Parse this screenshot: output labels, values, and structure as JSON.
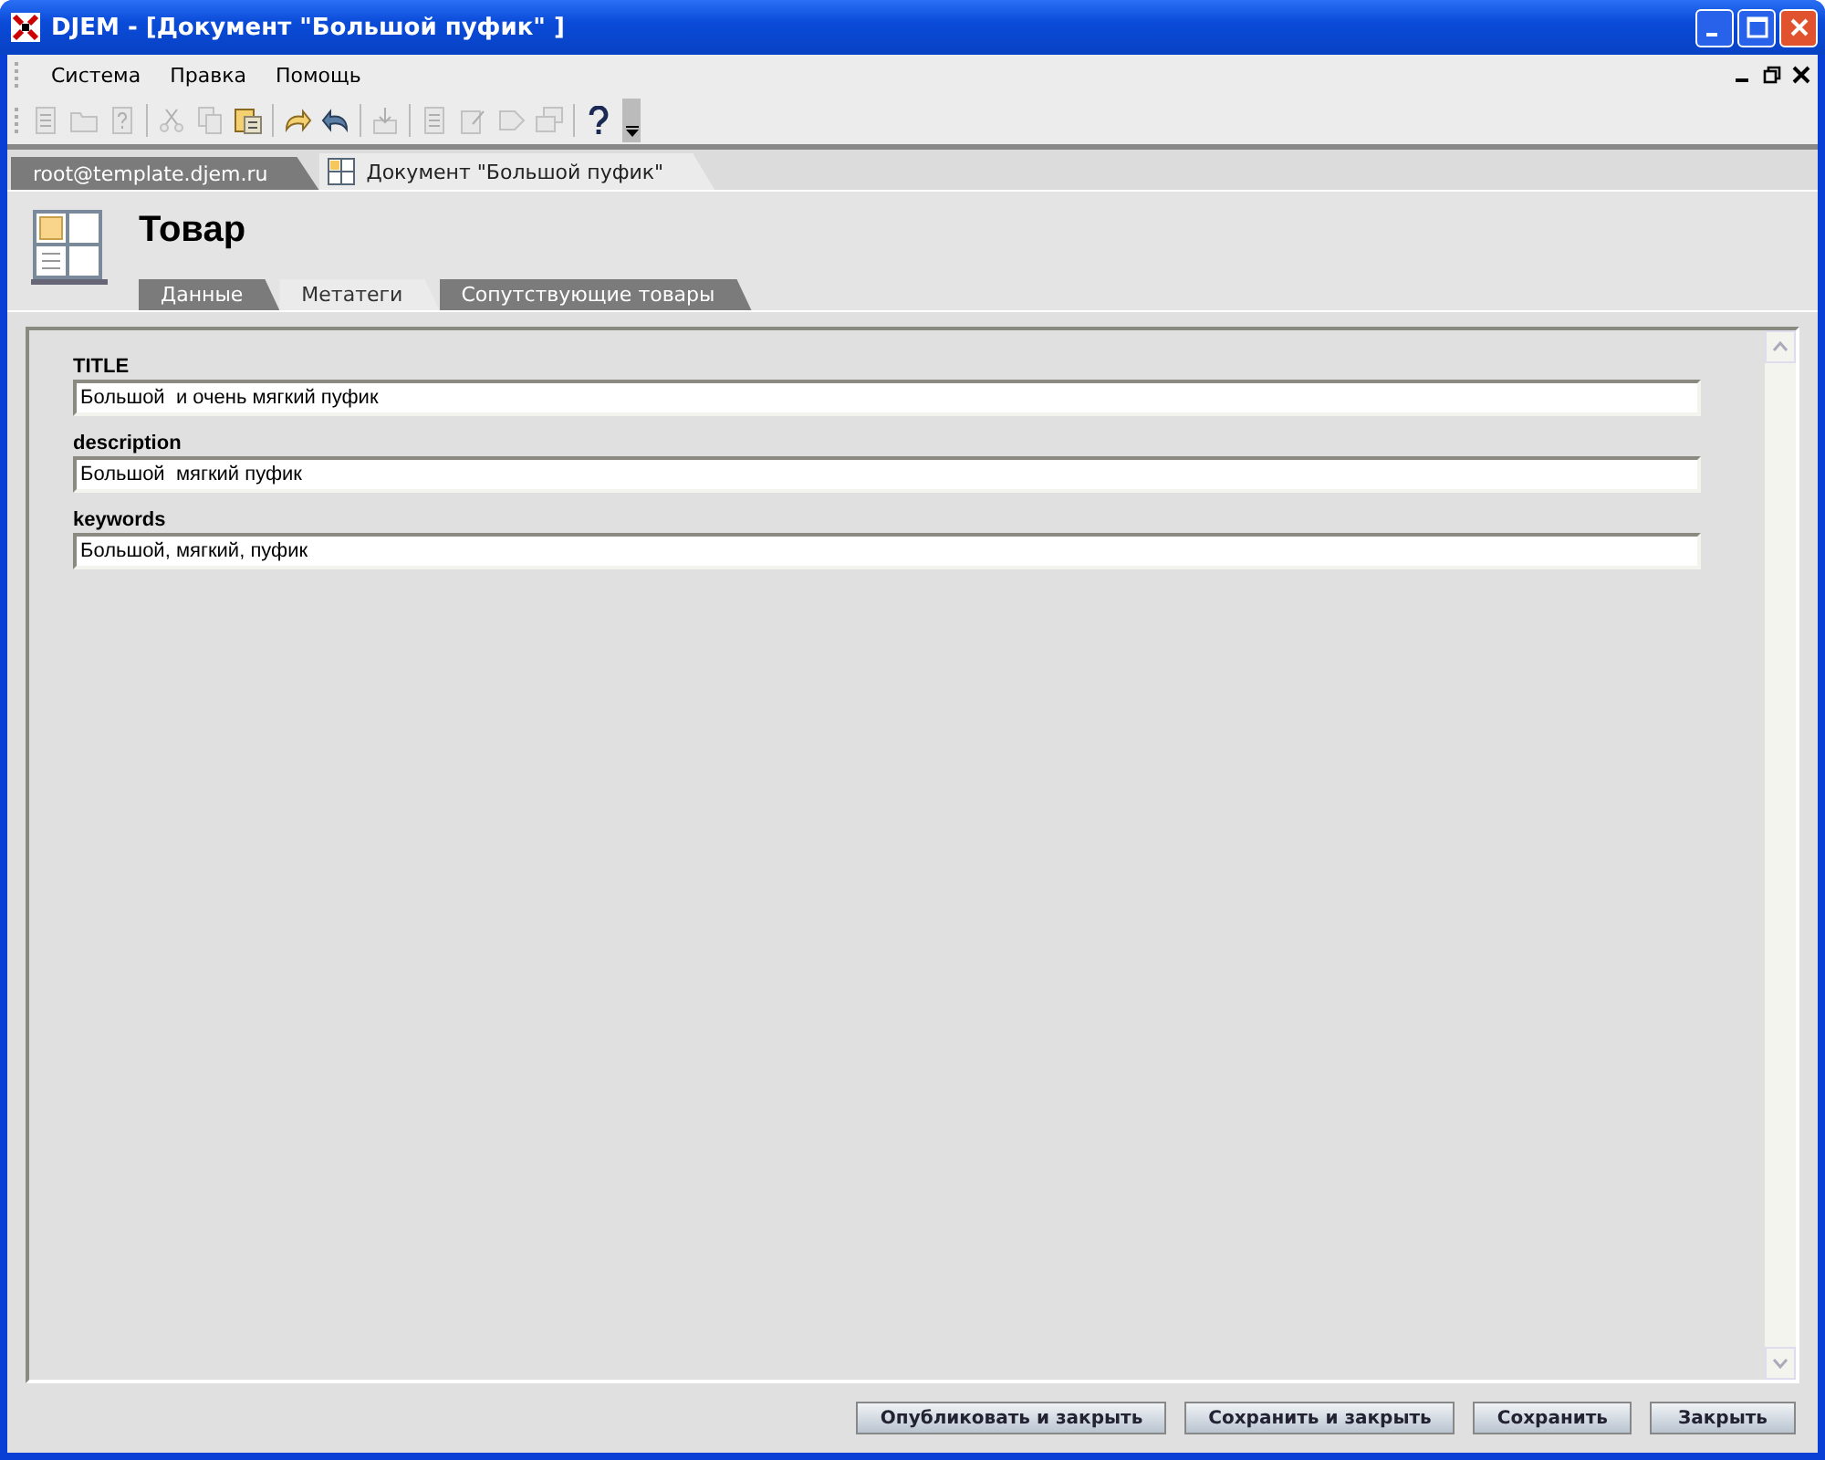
{
  "window": {
    "title": "DJEM - [Документ \"Большой пуфик\" ]"
  },
  "menu": [
    "Система",
    "Правка",
    "Помощь"
  ],
  "toolbar": [
    {
      "kind": "page",
      "disabled": true
    },
    {
      "kind": "folder",
      "disabled": true
    },
    {
      "kind": "help-page",
      "disabled": true
    },
    {
      "kind": "separator"
    },
    {
      "kind": "scissors",
      "disabled": true
    },
    {
      "kind": "copy",
      "disabled": true
    },
    {
      "kind": "paste",
      "disabled": false
    },
    {
      "kind": "separator"
    },
    {
      "kind": "redo",
      "disabled": false
    },
    {
      "kind": "undo",
      "disabled": false
    },
    {
      "kind": "separator"
    },
    {
      "kind": "tray",
      "disabled": true
    },
    {
      "kind": "separator"
    },
    {
      "kind": "page",
      "disabled": true
    },
    {
      "kind": "edit",
      "disabled": true
    },
    {
      "kind": "arrow",
      "disabled": true
    },
    {
      "kind": "windows",
      "disabled": true
    },
    {
      "kind": "separator"
    },
    {
      "kind": "help",
      "disabled": false
    }
  ],
  "doc_tabs": [
    {
      "label": "root@template.djem.ru",
      "selected": false,
      "icon": false
    },
    {
      "label": "Документ \"Большой пуфик\"",
      "selected": true,
      "icon": true
    }
  ],
  "header": {
    "title": "Товар"
  },
  "form_tabs": [
    {
      "label": "Данные",
      "selected": false
    },
    {
      "label": "Метатеги",
      "selected": true
    },
    {
      "label": "Сопутствующие товары",
      "selected": false
    }
  ],
  "fields": [
    {
      "label": "TITLE",
      "value": "Большой  и очень мягкий пуфик"
    },
    {
      "label": "description",
      "value": "Большой  мягкий пуфик"
    },
    {
      "label": "keywords",
      "value": "Большой, мягкий, пуфик"
    }
  ],
  "buttons": [
    "Опубликовать и закрыть",
    "Сохранить и закрыть",
    "Сохранить",
    "Закрыть"
  ]
}
